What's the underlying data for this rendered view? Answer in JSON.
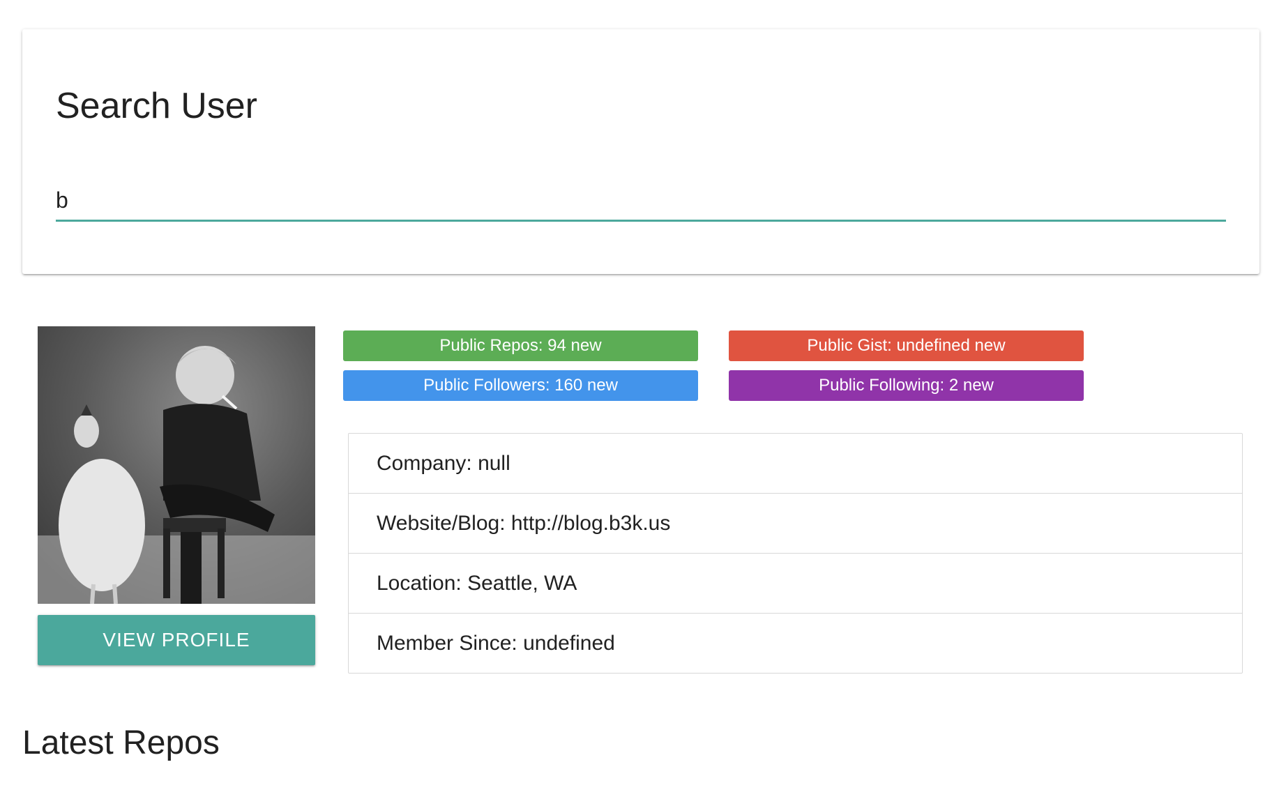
{
  "search": {
    "title": "Search User",
    "value": "b"
  },
  "profile": {
    "avatar_alt": "",
    "view_profile_label": "VIEW PROFILE"
  },
  "badges": {
    "repos": "Public Repos: 94 new",
    "gists": "Public Gist: undefined new",
    "followers": "Public Followers: 160 new",
    "following": "Public Following: 2 new"
  },
  "info": {
    "company": "Company: null",
    "website": "Website/Blog: http://blog.b3k.us",
    "location": "Location: Seattle, WA",
    "member_since": "Member Since: undefined"
  },
  "repos": {
    "title": "Latest Repos"
  },
  "colors": {
    "accent": "#4ba89c",
    "repos": "#5cad55",
    "gists": "#e05440",
    "followers": "#4394eb",
    "following": "#9034a9"
  }
}
